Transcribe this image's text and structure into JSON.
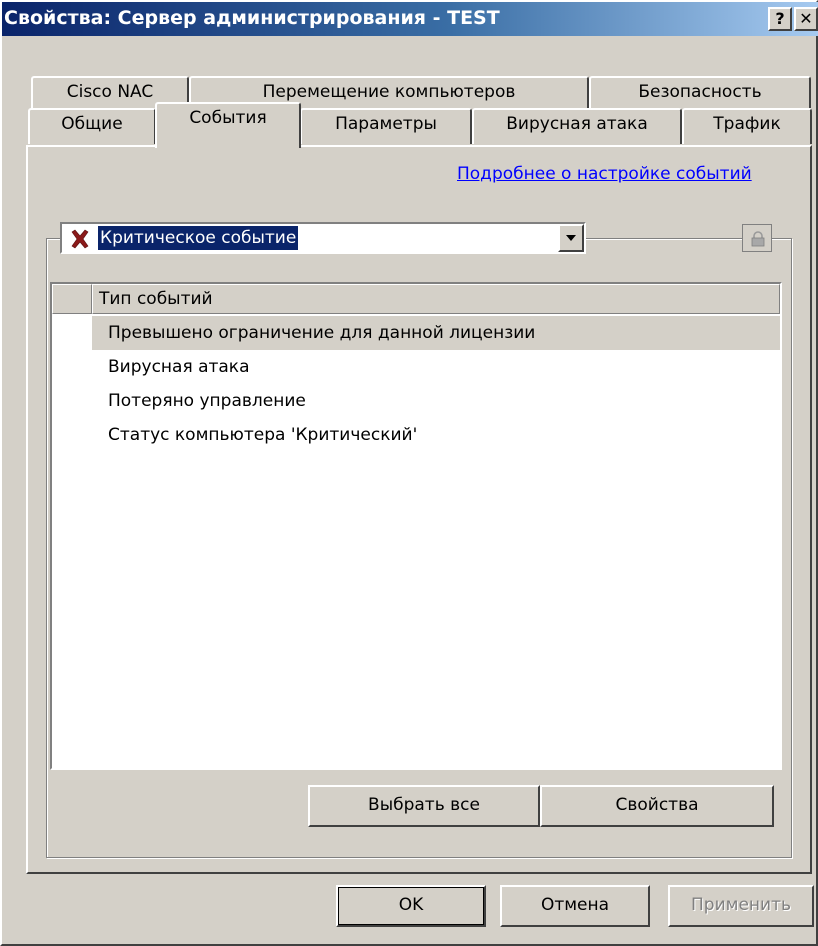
{
  "window": {
    "title": "Свойства: Сервер администрирования - TEST",
    "help_button": "?",
    "close_button": "✕"
  },
  "tabs": {
    "row1": [
      {
        "label": "Cisco NAC"
      },
      {
        "label": "Перемещение компьютеров"
      },
      {
        "label": "Безопасность"
      }
    ],
    "row2": [
      {
        "label": "Общие"
      },
      {
        "label": "События",
        "active": true
      },
      {
        "label": "Параметры"
      },
      {
        "label": "Вирусная атака"
      },
      {
        "label": "Трафик"
      }
    ]
  },
  "events_page": {
    "more_link": "Подробнее о настройке событий",
    "severity_select": {
      "value": "Критическое событие",
      "icon": "red-x-icon"
    },
    "lock_icon": "lock-icon",
    "list": {
      "columns": [
        "",
        "Тип событий"
      ],
      "rows": [
        {
          "label": "Превышено ограничение для данной лицензии",
          "selected": true
        },
        {
          "label": "Вирусная атака"
        },
        {
          "label": "Потеряно управление"
        },
        {
          "label": "Статус компьютера 'Критический'"
        }
      ]
    },
    "buttons": {
      "select_all": "Выбрать все",
      "properties": "Свойства"
    }
  },
  "dialog_buttons": {
    "ok": "OK",
    "cancel": "Отмена",
    "apply": "Применить"
  },
  "colors": {
    "title_gradient_start": "#0a246a",
    "link": "#0000ff",
    "selection": "#0a246a",
    "face": "#d4d0c8",
    "red_x": "#8b1a1a"
  }
}
